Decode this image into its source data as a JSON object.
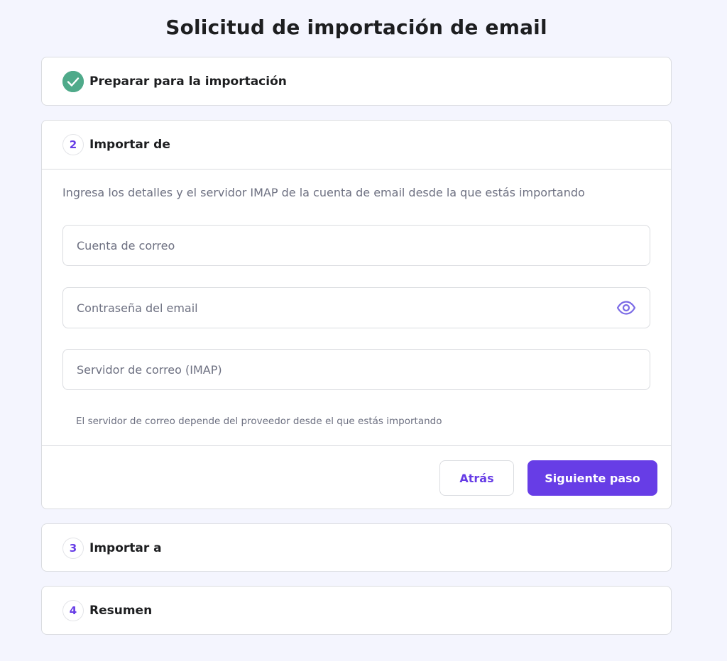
{
  "page": {
    "title": "Solicitud de importación de email"
  },
  "steps": [
    {
      "number": "1",
      "title": "Preparar para la importación",
      "status": "completed",
      "icon": "check-icon"
    },
    {
      "number": "2",
      "title": "Importar de",
      "status": "active"
    },
    {
      "number": "3",
      "title": "Importar a",
      "status": "pending"
    },
    {
      "number": "4",
      "title": "Resumen",
      "status": "pending"
    }
  ],
  "import_from": {
    "intro": "Ingresa los detalles y el servidor IMAP de la cuenta de email desde la que estás importando",
    "email_account": {
      "value": "",
      "placeholder": "Cuenta de correo"
    },
    "email_password": {
      "value": "",
      "placeholder": "Contraseña del email",
      "icon": "eye-icon"
    },
    "mail_server": {
      "value": "",
      "placeholder": "Servidor de correo (IMAP)"
    },
    "hint": "El servidor de correo depende del proveedor desde el que estás importando",
    "back_label": "Atrás",
    "next_label": "Siguiente paso"
  },
  "colors": {
    "accent": "#673de6",
    "success": "#4faa8a",
    "background": "#f4f5fe",
    "muted_text": "#6d7081"
  }
}
